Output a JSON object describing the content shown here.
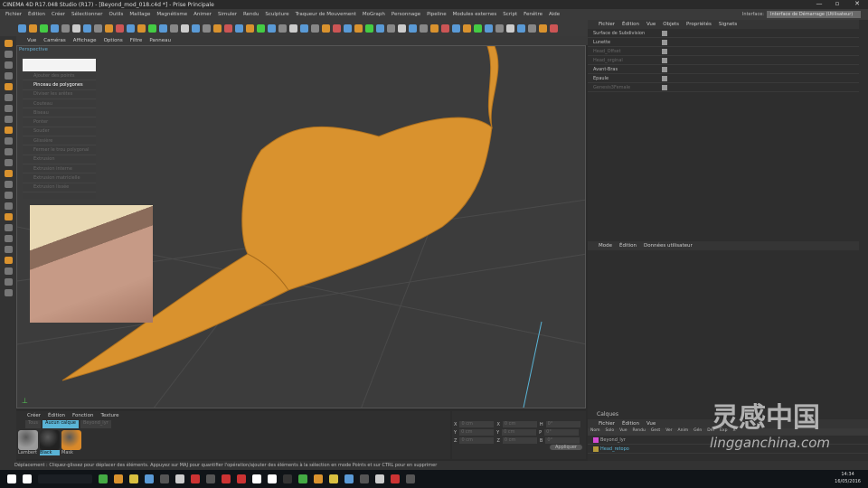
{
  "title": "CINEMA 4D R17.048 Studio (R17) - [Beyond_mod_018.c4d *] - Prise Principale",
  "menubar": [
    "Fichier",
    "Édition",
    "Créer",
    "Sélectionner",
    "Outils",
    "Maillage",
    "Magnétisme",
    "Animer",
    "Simuler",
    "Rendu",
    "Sculpture",
    "Traqueur de Mouvement",
    "MoGraph",
    "Personnage",
    "Pipeline",
    "Modules externes",
    "Script",
    "Fenêtre",
    "Aide"
  ],
  "interface": {
    "label": "Interface:",
    "value": "Interface de Démarrage (Utilisateur)"
  },
  "viewport": {
    "menu": [
      "Vue",
      "Caméras",
      "Affichage",
      "Options",
      "Filtre",
      "Panneau"
    ],
    "label": "Perspective",
    "popup": [
      "Ajouter des points",
      "Pinceau de polygones",
      "Diviser les arêtes",
      "Couteau",
      "Biseau",
      "Ponter",
      "Souder",
      "Glissière",
      "Fermer le trou polygonal",
      "Extrusion",
      "Extrusion interne",
      "Extrusion matricielle",
      "Extrusion lissée"
    ],
    "active_index": 1
  },
  "objects": {
    "menu": [
      "Fichier",
      "Édition",
      "Vue",
      "Objets",
      "Propriétés",
      "Signets"
    ],
    "rows": [
      {
        "name": "Surface de Subdivision",
        "dim": false
      },
      {
        "name": "Lunette",
        "dim": false
      },
      {
        "name": "Head_Offset",
        "dim": true
      },
      {
        "name": "Head_orginal",
        "dim": true
      },
      {
        "name": "Avant-Bras",
        "dim": false
      },
      {
        "name": "Epaule",
        "dim": false
      },
      {
        "name": "Genesis3Female",
        "dim": true
      }
    ]
  },
  "attributes": {
    "menu": [
      "Mode",
      "Édition",
      "Données utilisateur"
    ]
  },
  "layers": {
    "title": "Calques",
    "menu": [
      "Fichier",
      "Édition",
      "Vue"
    ],
    "columns": [
      "Nom",
      "Solo",
      "Vue",
      "Rendu",
      "Gest",
      "Ver",
      "Anim",
      "Gén",
      "Déf",
      "Exp",
      "X"
    ],
    "rows": [
      {
        "name": "Beyond_lyr",
        "color": "#d24bd2"
      },
      {
        "name": "Head_retopo",
        "color": "#b59a3a"
      }
    ]
  },
  "materials": {
    "menu": [
      "Créer",
      "Édition",
      "Fonction",
      "Texture"
    ],
    "tabs": [
      "Tous",
      "Aucun calque",
      "Beyond_lyr"
    ],
    "items": [
      {
        "name": "Lambert",
        "color": "#9a9a9a"
      },
      {
        "name": "Black",
        "color": "#222"
      },
      {
        "name": "Mask",
        "color": "#d9892a"
      }
    ]
  },
  "coords": {
    "rows": [
      [
        "X",
        "0 cm",
        "X",
        "0 cm",
        "H",
        "0°"
      ],
      [
        "Y",
        "0 cm",
        "Y",
        "0 cm",
        "P",
        "0°"
      ],
      [
        "Z",
        "0 cm",
        "Z",
        "0 cm",
        "B",
        "0°"
      ]
    ],
    "apply": "Appliquer"
  },
  "status": "Déplacement : Cliquez-glissez pour déplacer des éléments. Appuyez sur MAJ pour quantifier l'opération/ajouter des éléments à la sélection en mode Points et sur CTRL pour en supprimer",
  "clock": {
    "time": "14:34",
    "date": "16/05/2016"
  },
  "watermark": {
    "cn": "灵感中国",
    "en": "lingganchina.com"
  },
  "colors": {
    "model": "#d9922e",
    "accent": "#5ab4d6"
  }
}
